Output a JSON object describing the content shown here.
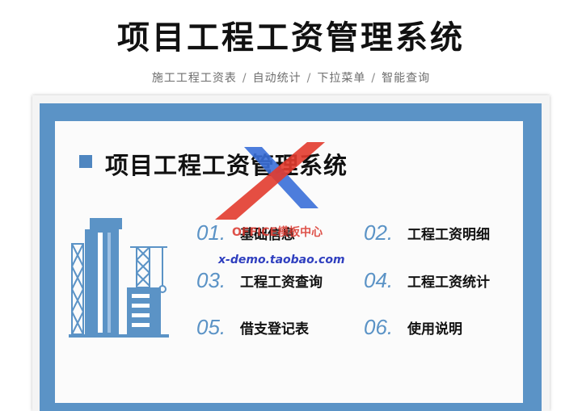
{
  "header": {
    "title": "项目工程工资管理系统",
    "features": [
      "施工工程工资表",
      "自动统计",
      "下拉菜单",
      "智能查询"
    ],
    "separator": "/"
  },
  "card": {
    "title": "项目工程工资管理系统",
    "menu": [
      {
        "num": "01.",
        "label": "基础信息"
      },
      {
        "num": "02.",
        "label": "工程工资明细"
      },
      {
        "num": "03.",
        "label": "工程工资查询"
      },
      {
        "num": "04.",
        "label": "工程工资统计"
      },
      {
        "num": "05.",
        "label": "借支登记表"
      },
      {
        "num": "06.",
        "label": "使用说明"
      }
    ]
  },
  "watermark": {
    "brand": "OFFICE模板中心",
    "url": "x-demo.taobao.com"
  },
  "colors": {
    "accent": "#5b93c6",
    "text": "#111111",
    "watermark_red": "#d9342b",
    "watermark_blue": "#2f3fbf"
  },
  "icons": [
    "building-crane-illustration",
    "x-logo-watermark"
  ]
}
